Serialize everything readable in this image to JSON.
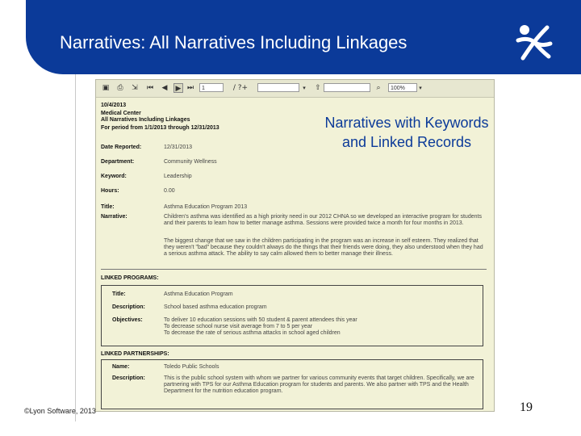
{
  "slide": {
    "title": "Narratives:  All Narratives Including Linkages",
    "footer": "©Lyon Software, 2013",
    "page_number": "19",
    "callout": "Narratives with Keywords and Linked Records",
    "logo_icon": "stick-figure-logo-icon",
    "header_color": "#0B3A99"
  },
  "toolbar": {
    "page_value": "1",
    "find_label": "Find",
    "zoom_value": "100%",
    "icons": [
      "save-icon",
      "print-icon",
      "export-icon",
      "first-page-icon",
      "prev-page-icon",
      "next-page-icon",
      "last-page-icon",
      "search-icon",
      "refresh-icon"
    ]
  },
  "report": {
    "date": "10/4/2013",
    "org": "Medical Center",
    "heading": "All Narratives Including Linkages",
    "period": "For period from 1/1/2013 through 12/31/2013",
    "fields": [
      {
        "label": "Date Reported:",
        "value": "12/31/2013"
      },
      {
        "label": "Department:",
        "value": "Community Wellness"
      },
      {
        "label": "Keyword:",
        "value": "Leadership"
      },
      {
        "label": "Hours:",
        "value": "0.00"
      },
      {
        "label": "Title:",
        "value": "Asthma Education Program 2013"
      }
    ],
    "narrative_label": "Narrative:",
    "narrative_p1": "Children's asthma was identified as a high priority need in our 2012 CHNA so we developed an interactive program for students and their parents to learn how to better manage asthma. Sessions were provided twice a month for four months in 2013.",
    "narrative_p2": "The biggest change that we saw in the children participating in the program was an increase in self esteem. They realized that they weren't \"bad\" because they couldn't always do the things that their friends were doing, they also understood when they had a serious asthma attack. The ability to say calm allowed them to better manage their illness.",
    "linked_programs_heading": "LINKED PROGRAMS:",
    "program": {
      "title_label": "Title:",
      "title_value": "Asthma Education Program",
      "description_label": "Description:",
      "description_value": "School based asthma education program",
      "objectives_label": "Objectives:",
      "objectives_lines": [
        "To deliver 10 education sessions with 50 student & parent attendees this year",
        "To decrease school nurse visit average from 7 to 5 per year",
        "To decrease the rate of serious asthma attacks in school aged children"
      ]
    },
    "linked_partnerships_heading": "LINKED PARTNERSHIPS:",
    "partnership": {
      "name_label": "Name:",
      "name_value": "Toledo Public Schools",
      "description_label": "Description:",
      "description_value": "This is the public school system with whom we partner for various community events that target children. Specifically, we are partnering with TPS for our Asthma Education program for students and parents. We also partner with TPS and the Health Department for the nutrition education program."
    }
  }
}
